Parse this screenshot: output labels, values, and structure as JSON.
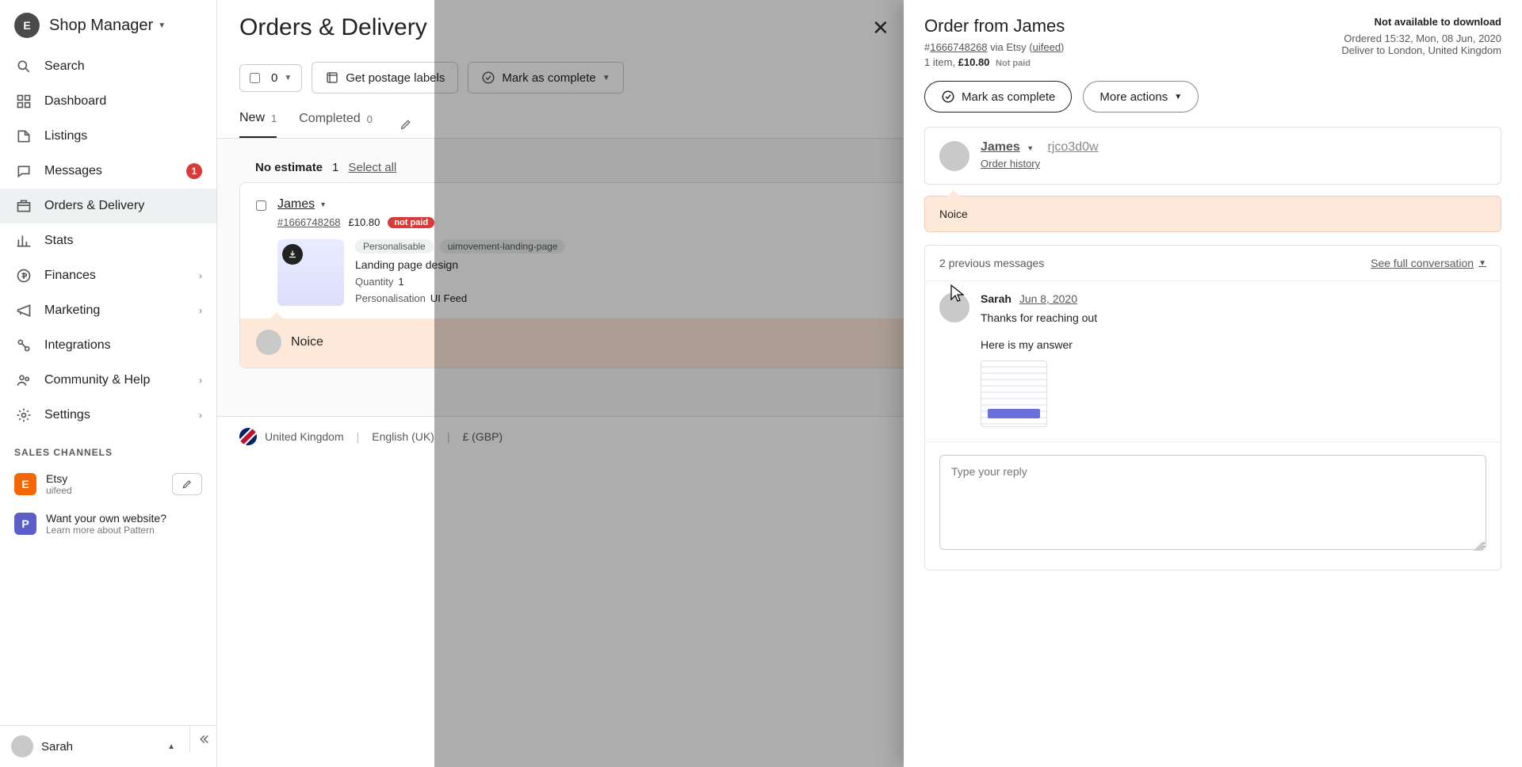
{
  "brand": {
    "avatar_letter": "E",
    "title": "Shop Manager"
  },
  "sidebar": {
    "items": [
      {
        "label": "Search",
        "icon": "search"
      },
      {
        "label": "Dashboard",
        "icon": "dashboard"
      },
      {
        "label": "Listings",
        "icon": "listings"
      },
      {
        "label": "Messages",
        "icon": "messages",
        "badge": "1"
      },
      {
        "label": "Orders & Delivery",
        "icon": "orders",
        "active": true
      },
      {
        "label": "Stats",
        "icon": "stats"
      },
      {
        "label": "Finances",
        "icon": "finances",
        "caret": true
      },
      {
        "label": "Marketing",
        "icon": "marketing",
        "caret": true
      },
      {
        "label": "Integrations",
        "icon": "integrations"
      },
      {
        "label": "Community & Help",
        "icon": "community",
        "caret": true
      },
      {
        "label": "Settings",
        "icon": "settings",
        "caret": true
      }
    ],
    "sales_header": "SALES CHANNELS",
    "channels": {
      "etsy": {
        "letter": "E",
        "name": "Etsy",
        "sub": "uifeed"
      },
      "pattern": {
        "letter": "P",
        "line1": "Want your own website?",
        "line2": "Learn more about Pattern"
      }
    },
    "footer": {
      "name": "Sarah"
    }
  },
  "main": {
    "title": "Orders & Delivery",
    "toolbar": {
      "select_count": "0",
      "postage": "Get postage labels",
      "mark_complete": "Mark as complete"
    },
    "tabs": [
      {
        "label": "New",
        "count": "1",
        "active": true
      },
      {
        "label": "Completed",
        "count": "0"
      }
    ],
    "group": {
      "title": "No estimate",
      "count": "1",
      "select_all": "Select all"
    },
    "order": {
      "buyer": "James",
      "order_link": "#1666748268",
      "price": "£10.80",
      "not_paid": "not paid",
      "chips": [
        "Personalisable",
        "uimovement-landing-page"
      ],
      "item_name": "Landing page design",
      "qty_label": "Quantity",
      "qty": "1",
      "pers_label": "Personalisation",
      "pers": "UI Feed",
      "note": "Noice"
    },
    "footer": {
      "region": "United Kingdom",
      "lang": "English (UK)",
      "currency": "£ (GBP)"
    }
  },
  "drawer": {
    "title": "Order from James",
    "not_download": "Not available to download",
    "meta": {
      "hash": "#",
      "order_id": "1666748268",
      "via": " via Etsy (",
      "shop": "uifeed",
      "close_paren": ")",
      "items_line": "1 item,",
      "price": "£10.80",
      "not_paid": "Not paid",
      "ordered": "Ordered 15:32, Mon, 08 Jun, 2020",
      "deliver": "Deliver to London, United Kingdom"
    },
    "actions": {
      "mark": "Mark as complete",
      "more": "More actions"
    },
    "buyer": {
      "name": "James",
      "handle": "rjco3d0w",
      "history": "Order history"
    },
    "note": "Noice",
    "messages": {
      "prev": "2 previous messages",
      "see_full": "See full conversation",
      "sender": "Sarah",
      "date": "Jun 8, 2020",
      "line1": "Thanks for reaching out",
      "line2": "Here is my answer"
    },
    "reply_placeholder": "Type your reply"
  }
}
